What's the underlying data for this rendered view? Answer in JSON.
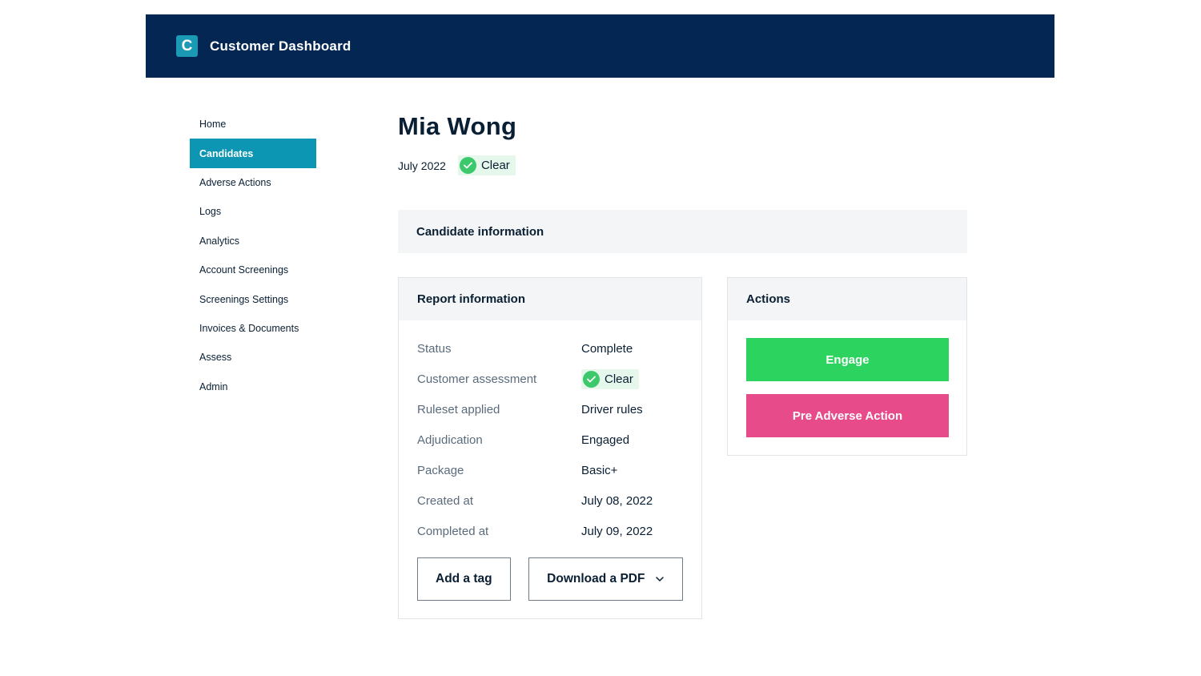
{
  "header": {
    "logo_letter": "C",
    "title": "Customer Dashboard",
    "background": "#032752",
    "logo_color": "#1a9ab4"
  },
  "sidebar": {
    "items": [
      {
        "label": "Home",
        "active": false
      },
      {
        "label": "Candidates",
        "active": true
      },
      {
        "label": "Adverse Actions",
        "active": false
      },
      {
        "label": "Logs",
        "active": false
      },
      {
        "label": "Analytics",
        "active": false
      },
      {
        "label": "Account Screenings",
        "active": false
      },
      {
        "label": "Screenings Settings",
        "active": false
      },
      {
        "label": "Invoices & Documents",
        "active": false
      },
      {
        "label": "Assess",
        "active": false
      },
      {
        "label": "Admin",
        "active": false
      }
    ],
    "active_color": "#0c96b3"
  },
  "candidate": {
    "name": "Mia Wong",
    "date": "July 2022",
    "status_badge": "Clear"
  },
  "candidate_info": {
    "title": "Candidate information"
  },
  "report": {
    "title": "Report information",
    "rows": [
      {
        "label": "Status",
        "value": "Complete"
      },
      {
        "label": "Customer assessment",
        "value": "Clear"
      },
      {
        "label": "Ruleset applied",
        "value": "Driver rules"
      },
      {
        "label": "Adjudication",
        "value": "Engaged"
      },
      {
        "label": "Package",
        "value": "Basic+"
      },
      {
        "label": "Created at",
        "value": "July 08, 2022"
      },
      {
        "label": "Completed at",
        "value": "July 09, 2022"
      }
    ],
    "add_tag_label": "Add a tag",
    "download_label": "Download a PDF"
  },
  "actions": {
    "title": "Actions",
    "engage_label": "Engage",
    "pre_adverse_label": "Pre Adverse Action",
    "engage_color": "#2dd35f",
    "pre_adverse_color": "#e84b8a"
  },
  "icons": {
    "badge_icon": "check-circle-icon",
    "dropdown_icon": "chevron-down-icon"
  }
}
